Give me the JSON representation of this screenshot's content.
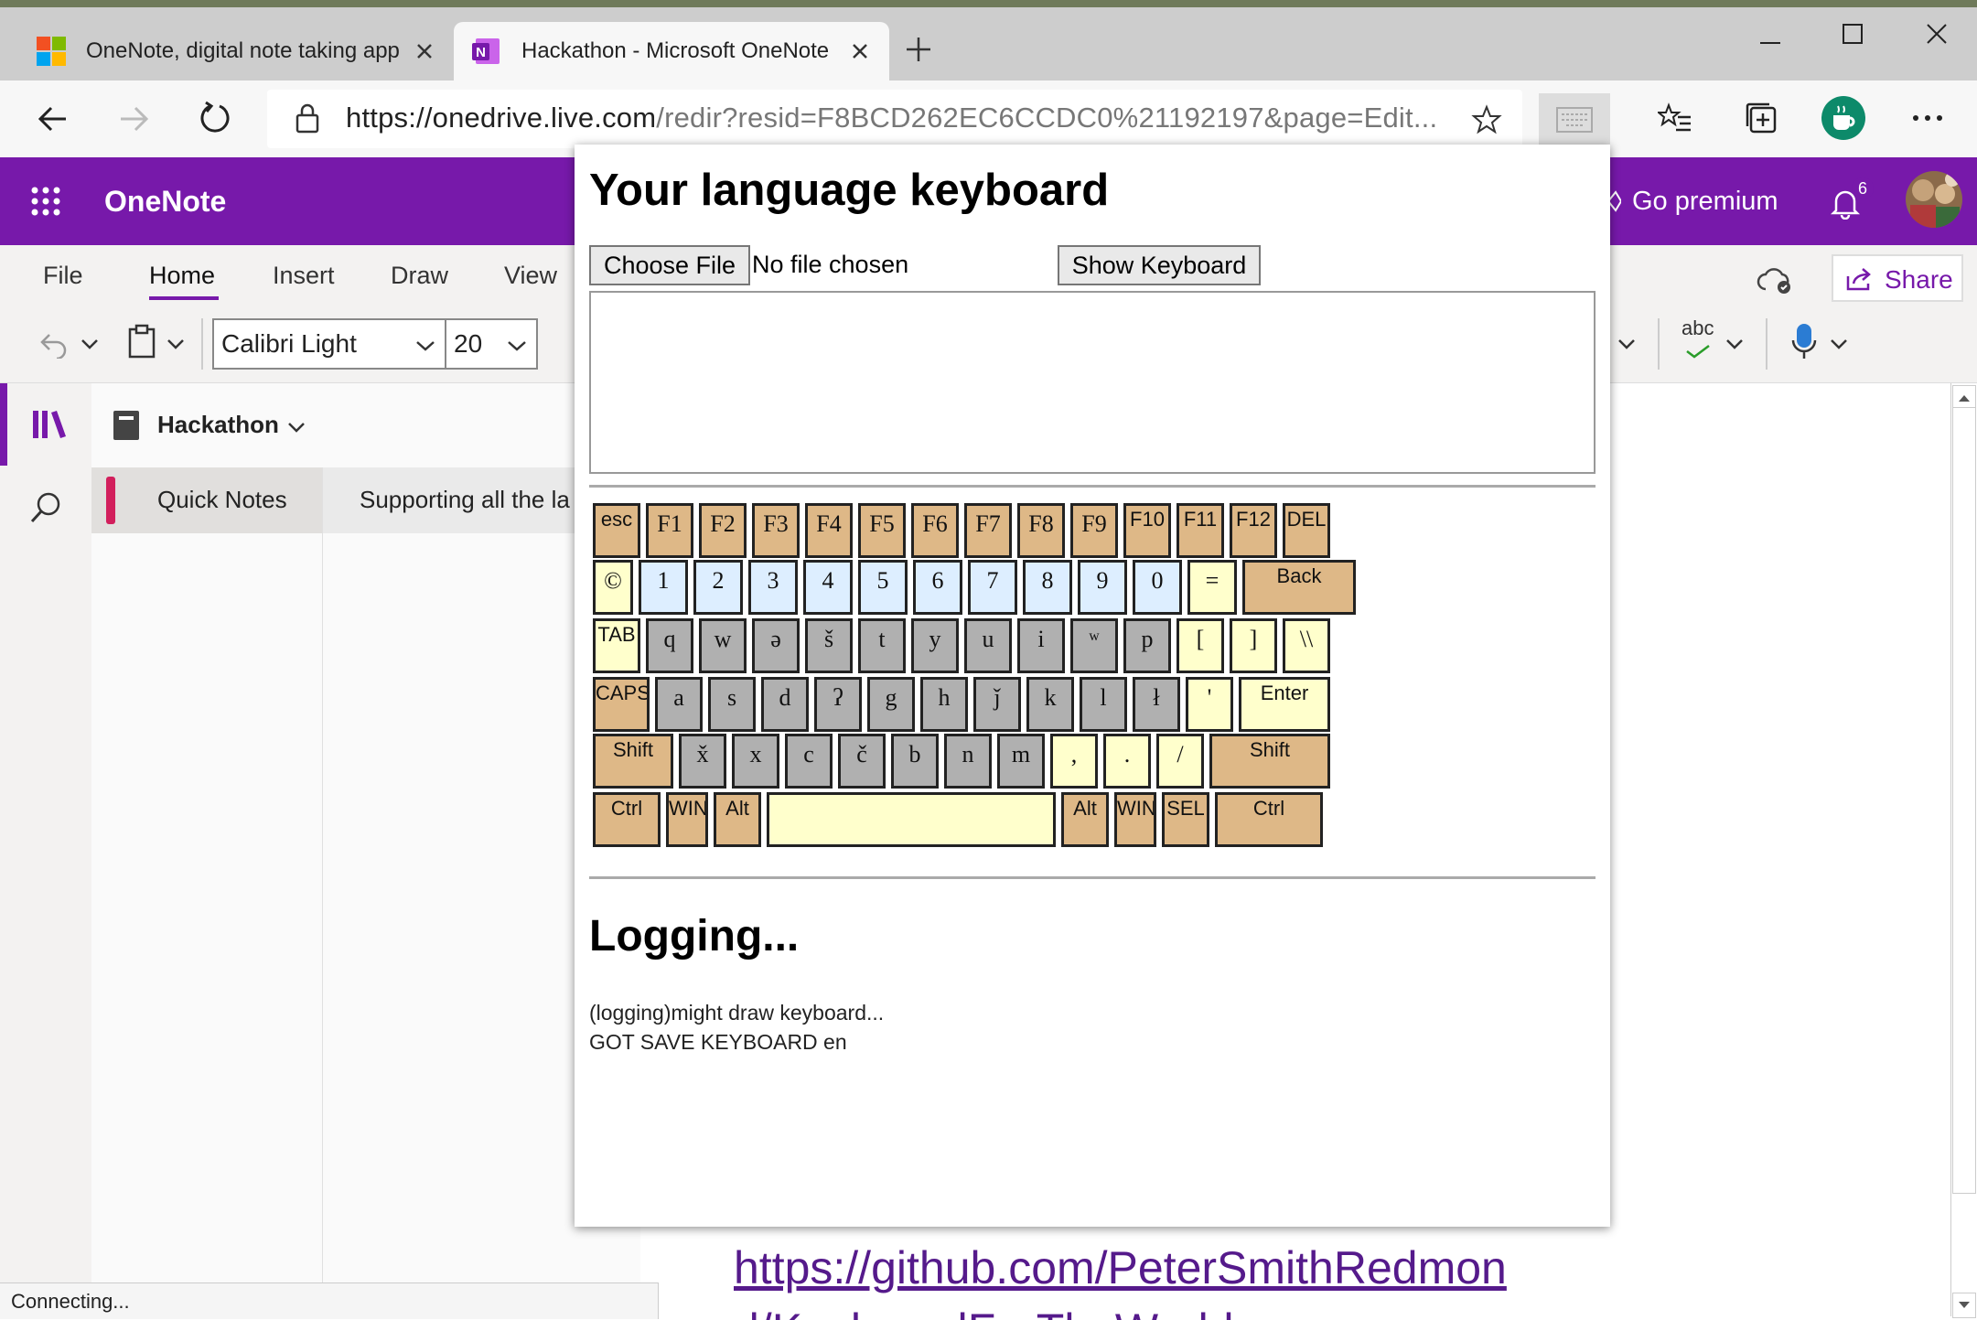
{
  "browser": {
    "tabs": [
      {
        "title": "OneNote, digital note taking app"
      },
      {
        "title": "Hackathon - Microsoft OneNote"
      }
    ],
    "url_host": "https://onedrive.live.com",
    "url_rest": "/redir?resid=F8BCD262EC6CCDC0%21192197&page=Edit..."
  },
  "onenote": {
    "app_name": "OneNote",
    "go_premium": "Go premium",
    "notification_count": "6",
    "ribbon_tabs": [
      "File",
      "Home",
      "Insert",
      "Draw",
      "View"
    ],
    "share_label": "Share",
    "font_name": "Calibri Light",
    "font_size": "20",
    "spell_label": "abc",
    "notebook_name": "Hackathon",
    "section_name": "Quick Notes",
    "page_title": "Supporting all the la",
    "link_text_1": "https://github.com/PeterSmithRedmon",
    "link_text_2": "d/KeyboardForTheWorld",
    "status": "Connecting..."
  },
  "popup": {
    "title": "Your language keyboard",
    "choose_file": "Choose File",
    "no_file": "No file chosen",
    "show_keyboard": "Show Keyboard",
    "logging_title": "Logging...",
    "log_lines": [
      "(logging)might draw keyboard...",
      "GOT SAVE KEYBOARD en"
    ]
  },
  "keyboard": {
    "rows": [
      [
        {
          "label": "esc",
          "color": "tan"
        },
        {
          "label": "F1",
          "color": "tan"
        },
        {
          "label": "F2",
          "color": "tan"
        },
        {
          "label": "F3",
          "color": "tan"
        },
        {
          "label": "F4",
          "color": "tan"
        },
        {
          "label": "F5",
          "color": "tan"
        },
        {
          "label": "F6",
          "color": "tan"
        },
        {
          "label": "F7",
          "color": "tan"
        },
        {
          "label": "F8",
          "color": "tan"
        },
        {
          "label": "F9",
          "color": "tan"
        },
        {
          "label": "F10",
          "color": "tan"
        },
        {
          "label": "F11",
          "color": "tan"
        },
        {
          "label": "F12",
          "color": "tan"
        },
        {
          "label": "DEL",
          "color": "tan"
        }
      ],
      [
        {
          "label": "©",
          "color": "ylw"
        },
        {
          "label": "1",
          "color": "blue"
        },
        {
          "label": "2",
          "color": "blue"
        },
        {
          "label": "3",
          "color": "blue"
        },
        {
          "label": "4",
          "color": "blue"
        },
        {
          "label": "5",
          "color": "blue"
        },
        {
          "label": "6",
          "color": "blue"
        },
        {
          "label": "7",
          "color": "blue"
        },
        {
          "label": "8",
          "color": "blue"
        },
        {
          "label": "9",
          "color": "blue"
        },
        {
          "label": "0",
          "color": "blue"
        },
        {
          "label": "=",
          "color": "ylw"
        },
        {
          "label": "Back",
          "color": "tan"
        }
      ],
      [
        {
          "label": "TAB",
          "color": "ylw"
        },
        {
          "label": "q",
          "color": "gray"
        },
        {
          "label": "w",
          "color": "gray"
        },
        {
          "label": "ə",
          "color": "gray"
        },
        {
          "label": "š",
          "color": "gray"
        },
        {
          "label": "t",
          "color": "gray"
        },
        {
          "label": "y",
          "color": "gray"
        },
        {
          "label": "u",
          "color": "gray"
        },
        {
          "label": "i",
          "color": "gray"
        },
        {
          "label": "ʷ",
          "color": "gray"
        },
        {
          "label": "p",
          "color": "gray"
        },
        {
          "label": "[",
          "color": "ylw"
        },
        {
          "label": "]",
          "color": "ylw"
        },
        {
          "label": "\\\\",
          "color": "ylw"
        }
      ],
      [
        {
          "label": "CAPS",
          "color": "tan"
        },
        {
          "label": "a",
          "color": "gray"
        },
        {
          "label": "s",
          "color": "gray"
        },
        {
          "label": "d",
          "color": "gray"
        },
        {
          "label": "ʔ",
          "color": "gray"
        },
        {
          "label": "g",
          "color": "gray"
        },
        {
          "label": "h",
          "color": "gray"
        },
        {
          "label": "ǰ",
          "color": "gray"
        },
        {
          "label": "k",
          "color": "gray"
        },
        {
          "label": "l",
          "color": "gray"
        },
        {
          "label": "ł",
          "color": "gray"
        },
        {
          "label": "'",
          "color": "ylw"
        },
        {
          "label": "Enter",
          "color": "ylw"
        }
      ],
      [
        {
          "label": "Shift",
          "color": "tan"
        },
        {
          "label": "x̌",
          "color": "gray"
        },
        {
          "label": "x",
          "color": "gray"
        },
        {
          "label": "c",
          "color": "gray"
        },
        {
          "label": "č",
          "color": "gray"
        },
        {
          "label": "b",
          "color": "gray"
        },
        {
          "label": "n",
          "color": "gray"
        },
        {
          "label": "m",
          "color": "gray"
        },
        {
          "label": ",",
          "color": "ylw"
        },
        {
          "label": ".",
          "color": "ylw"
        },
        {
          "label": "/",
          "color": "ylw"
        },
        {
          "label": "Shift",
          "color": "tan"
        }
      ],
      [
        {
          "label": "Ctrl",
          "color": "tan"
        },
        {
          "label": "WIN",
          "color": "tan"
        },
        {
          "label": "Alt",
          "color": "tan"
        },
        {
          "label": "",
          "color": "ylw"
        },
        {
          "label": "Alt",
          "color": "tan"
        },
        {
          "label": "WIN",
          "color": "tan"
        },
        {
          "label": "SEL",
          "color": "tan"
        },
        {
          "label": "Ctrl",
          "color": "tan"
        }
      ]
    ]
  }
}
